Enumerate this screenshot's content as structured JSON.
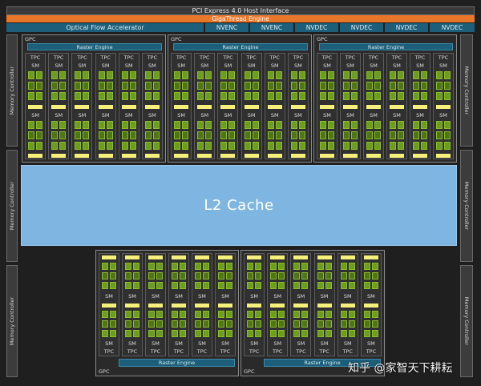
{
  "header": {
    "pci": "PCI Express 4.0 Host Interface",
    "gigathread": "GigaThread Engine",
    "optical_flow": "Optical Flow Accelerator",
    "codecs": [
      "NVENC",
      "NVENC",
      "NVDEC",
      "NVDEC",
      "NVDEC",
      "NVDEC"
    ]
  },
  "memory_controller_label": "Memory Controller",
  "l2_cache": "L2 Cache",
  "gpc": {
    "label": "GPC",
    "raster": "Raster Engine",
    "tpc": "TPC",
    "sm": "SM",
    "count": 5,
    "tpcs_per_gpc": 6,
    "sms_per_tpc": 2
  },
  "watermark": "知乎 @家智天下耕耘"
}
